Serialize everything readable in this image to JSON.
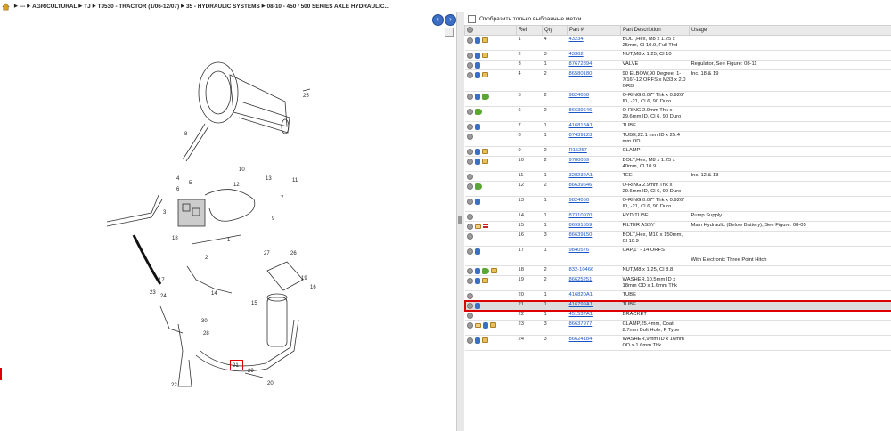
{
  "breadcrumb": {
    "items": [
      "---",
      "AGRICULTURAL",
      "TJ",
      "TJ530 - TRACTOR (1/06-12/07)",
      "35 - HYDRAULIC SYSTEMS",
      "08-10 - 450 / 500 SERIES AXLE HYDRAULIC..."
    ]
  },
  "filter": {
    "label": "Отобразить только выбранные метки"
  },
  "columns": {
    "ref": "Ref",
    "qty": "Qty",
    "part": "Part #",
    "desc": "Part Description",
    "usage": "Usage"
  },
  "callouts": [
    "25",
    "8",
    "4",
    "6",
    "5",
    "10",
    "13",
    "11",
    "3",
    "12",
    "18",
    "7",
    "9",
    "17",
    "14",
    "1",
    "2",
    "27",
    "26",
    "19",
    "16",
    "15",
    "23",
    "24",
    "21",
    "20",
    "22",
    "30",
    "28",
    "29"
  ],
  "rows": [
    {
      "icons": [
        "info",
        "cart",
        "note"
      ],
      "ref": "1",
      "qty": "4",
      "part": "43234",
      "desc": "BOLT,Hex, M8 x 1.25 x 25mm, Cl 10.9, Full Thd",
      "usage": ""
    },
    {
      "icons": [
        "info",
        "cart",
        "note"
      ],
      "ref": "2",
      "qty": "3",
      "part": "43362",
      "desc": "NUT,M8 x 1.25, Cl 10",
      "usage": ""
    },
    {
      "icons": [
        "info",
        "cart"
      ],
      "ref": "3",
      "qty": "1",
      "part": "87672894",
      "desc": "VALVE",
      "usage": "Regulator, See Figure: 08-11"
    },
    {
      "icons": [
        "info",
        "cart",
        "note"
      ],
      "ref": "4",
      "qty": "2",
      "part": "86580180",
      "desc": "90 ELBOW,90 Degree, 1-7/16\"-12 ORFS x M33 x 2.0 ORB",
      "usage": "Inc. 18 & 19"
    },
    {
      "icons": [
        "info",
        "cart",
        "green"
      ],
      "ref": "5",
      "qty": "2",
      "part": "9824050",
      "desc": "O-RING,0.07\" Thk x 0.926\" ID, -21, Cl 6, 90 Duro",
      "usage": ""
    },
    {
      "icons": [
        "info",
        "green"
      ],
      "ref": "6",
      "qty": "2",
      "part": "86639646",
      "desc": "O-RING,2.9mm Thk x 29.6mm ID, Cl 6, 90 Duro",
      "usage": ""
    },
    {
      "icons": [
        "info",
        "cart"
      ],
      "ref": "7",
      "qty": "1",
      "part": "416818A1",
      "desc": "TUBE",
      "usage": ""
    },
    {
      "icons": [
        "info"
      ],
      "ref": "8",
      "qty": "1",
      "part": "87439123",
      "desc": "TUBE,22.1 mm ID x 25.4 mm OD",
      "usage": ""
    },
    {
      "icons": [
        "info",
        "cart",
        "note"
      ],
      "ref": "9",
      "qty": "2",
      "part": "R15257",
      "desc": "CLAMP",
      "usage": ""
    },
    {
      "icons": [
        "info",
        "cart",
        "note"
      ],
      "ref": "10",
      "qty": "2",
      "part": "9780069",
      "desc": "BOLT,Hex, M8 x 1.25 x 40mm, Cl 10.9",
      "usage": ""
    },
    {
      "icons": [
        "info"
      ],
      "ref": "11",
      "qty": "1",
      "part": "328232A1",
      "desc": "TEE",
      "usage": "Inc. 12 & 13"
    },
    {
      "icons": [
        "info",
        "green"
      ],
      "ref": "12",
      "qty": "2",
      "part": "86639646",
      "desc": "O-RING,2.9mm Thk x 29.6mm ID, Cl 6, 90 Duro",
      "usage": ""
    },
    {
      "icons": [
        "info",
        "cart"
      ],
      "ref": "13",
      "qty": "1",
      "part": "9824050",
      "desc": "O-RING,0.07\" Thk x 0.926\" ID, -21, Cl 6, 90 Duro",
      "usage": ""
    },
    {
      "icons": [
        "info"
      ],
      "ref": "14",
      "qty": "1",
      "part": "87310970",
      "desc": "HYD TUBE",
      "usage": "Pump Supply"
    },
    {
      "icons": [
        "info",
        "env",
        "red"
      ],
      "ref": "15",
      "qty": "1",
      "part": "86991559",
      "desc": "FILTER ASSY",
      "usage": "Main Hydraulic (Below Battery), See Figure: 08-05"
    },
    {
      "icons": [
        "info"
      ],
      "ref": "16",
      "qty": "3",
      "part": "86639150",
      "desc": "BOLT,Hex, M10 x 150mm, Cl 10.9",
      "usage": ""
    },
    {
      "icons": [
        "info",
        "cart"
      ],
      "ref": "17",
      "qty": "1",
      "part": "9840576",
      "desc": "CAP,1\" - 14 ORFS",
      "usage": ""
    },
    {
      "icons": [],
      "ref": "",
      "qty": "",
      "part": "",
      "desc": "",
      "usage": "With Electronic Three Point Hitch"
    },
    {
      "icons": [
        "info",
        "cart",
        "green",
        "note"
      ],
      "ref": "18",
      "qty": "2",
      "part": "832-10466",
      "desc": "NUT,M8 x 1.25, Cl 8.8",
      "usage": ""
    },
    {
      "icons": [
        "info",
        "cart",
        "note"
      ],
      "ref": "19",
      "qty": "2",
      "part": "86625251",
      "desc": "WASHER,10.5mm ID x 18mm OD x 1.6mm Thk",
      "usage": ""
    },
    {
      "icons": [
        "info"
      ],
      "ref": "20",
      "qty": "1",
      "part": "416820A1",
      "desc": "TUBE",
      "usage": ""
    },
    {
      "icons": [
        "info",
        "cart"
      ],
      "ref": "21",
      "qty": "1",
      "part": "416799A1",
      "desc": "TUBE",
      "usage": "",
      "selected": true
    },
    {
      "icons": [
        "info"
      ],
      "ref": "22",
      "qty": "1",
      "part": "451537A1",
      "desc": "BRACKET",
      "usage": ""
    },
    {
      "icons": [
        "info",
        "env",
        "cart",
        "note"
      ],
      "ref": "23",
      "qty": "3",
      "part": "86637977",
      "desc": "CLAMP,25.4mm, Coat, 8.7mm Bolt Hole, P Type",
      "usage": ""
    },
    {
      "icons": [
        "info",
        "cart",
        "note"
      ],
      "ref": "24",
      "qty": "3",
      "part": "86624184",
      "desc": "WASHER,9mm ID x 16mm OD x 1.6mm Thk",
      "usage": ""
    }
  ]
}
